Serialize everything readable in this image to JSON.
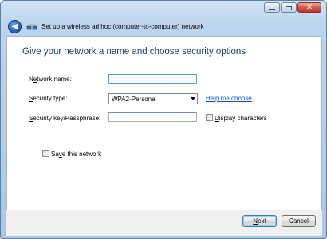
{
  "window": {
    "title": "Set up a wireless ad hoc (computer-to-computer) network",
    "caption_buttons": {
      "minimize": "minimize",
      "maximize": "maximize",
      "close": "✕"
    }
  },
  "page": {
    "heading": "Give your network a name and choose security options"
  },
  "form": {
    "network_name": {
      "label_pre": "N",
      "label_acc": "e",
      "label_post": "twork name:",
      "value": ""
    },
    "security_type": {
      "label_pre": "",
      "label_acc": "S",
      "label_post": "ecurity type:",
      "value": "WPA2-Personal"
    },
    "help_link": "Help me choose",
    "security_key": {
      "label_pre": "",
      "label_acc": "S",
      "label_post": "ecurity key/Passphrase:",
      "value": ""
    },
    "display_characters": {
      "label_pre": "",
      "label_acc": "D",
      "label_post": "isplay characters",
      "checked": false
    },
    "save_network": {
      "label_pre": "Sa",
      "label_acc": "v",
      "label_post": "e this network",
      "checked": false
    }
  },
  "footer": {
    "next": {
      "label_acc": "N",
      "label_post": "ext"
    },
    "cancel": "Cancel"
  },
  "icons": {
    "back": "back-arrow-icon",
    "network": "wireless-network-icon"
  },
  "colors": {
    "heading": "#1a3a73",
    "link": "#0b52c4",
    "chrome": "#bcd5ee"
  }
}
